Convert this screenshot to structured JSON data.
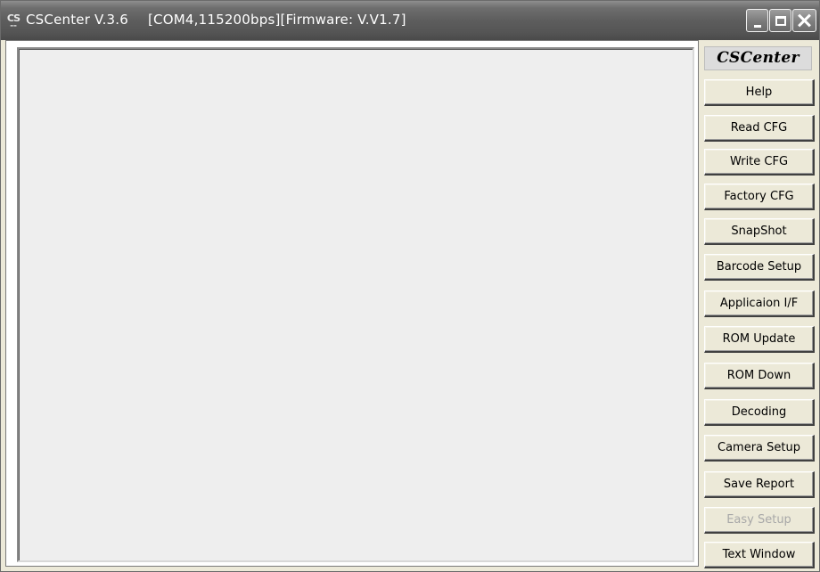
{
  "window": {
    "title": "CSCenter V.3.6",
    "status": "[COM4,115200bps][Firmware: V.V1.7]",
    "icon": "cs-app-icon",
    "icon_text": "CS",
    "controls": [
      "minimize",
      "maximize",
      "close"
    ]
  },
  "sidebar": {
    "header": "CSCenter",
    "buttons": [
      {
        "label": "Help",
        "enabled": true
      },
      {
        "label": "Read CFG",
        "enabled": true
      },
      {
        "label": "Write CFG",
        "enabled": true
      },
      {
        "label": "Factory CFG",
        "enabled": true
      },
      {
        "label": "SnapShot",
        "enabled": true
      },
      {
        "label": "Barcode Setup",
        "enabled": true
      },
      {
        "label": "Applicaion I/F",
        "enabled": true
      },
      {
        "label": "ROM Update",
        "enabled": true
      },
      {
        "label": "ROM Down",
        "enabled": true
      },
      {
        "label": "Decoding",
        "enabled": true
      },
      {
        "label": "Camera Setup",
        "enabled": true
      },
      {
        "label": "Save Report",
        "enabled": true
      },
      {
        "label": "Easy Setup",
        "enabled": false
      },
      {
        "label": "Text Window",
        "enabled": true
      }
    ]
  },
  "colors": {
    "titlebar": "#5d5d5d",
    "window_bg": "#ece9d8",
    "content_bg": "#eeeeee",
    "disabled_text": "#a8a8a8"
  }
}
